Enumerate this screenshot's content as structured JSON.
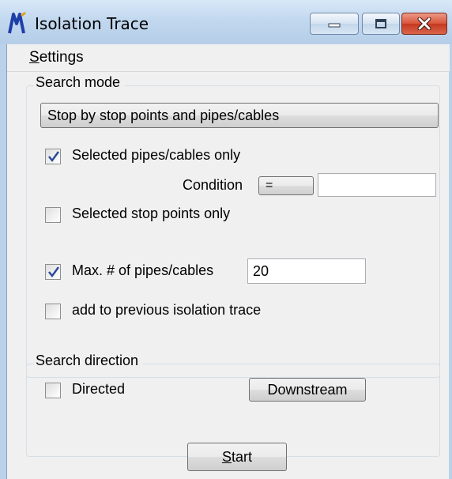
{
  "window": {
    "title": "Isolation Trace",
    "accent": "#b9d1ea",
    "controls": {
      "minimize": "minimize-icon",
      "maximize": "maximize-icon",
      "close": "close-icon"
    }
  },
  "menu": {
    "settings_first": "S",
    "settings_rest": "ettings"
  },
  "search_mode": {
    "title": "Search mode",
    "mode_button": "Stop by stop points and pipes/cables",
    "selected_pipes_only": {
      "label": "Selected pipes/cables only",
      "checked": true
    },
    "condition": {
      "label": "Condition",
      "operator": "=",
      "value": ""
    },
    "selected_stop_points_only": {
      "label": "Selected stop points only",
      "checked": false
    },
    "max_pipes": {
      "label": "Max. # of pipes/cables",
      "checked": true,
      "value": "20"
    },
    "add_to_previous": {
      "label": "add to previous isolation trace",
      "checked": false
    }
  },
  "search_direction": {
    "title": "Search direction",
    "directed": {
      "label": "Directed",
      "checked": false
    },
    "direction_button": "Downstream"
  },
  "start": {
    "first": "S",
    "rest": "tart"
  }
}
